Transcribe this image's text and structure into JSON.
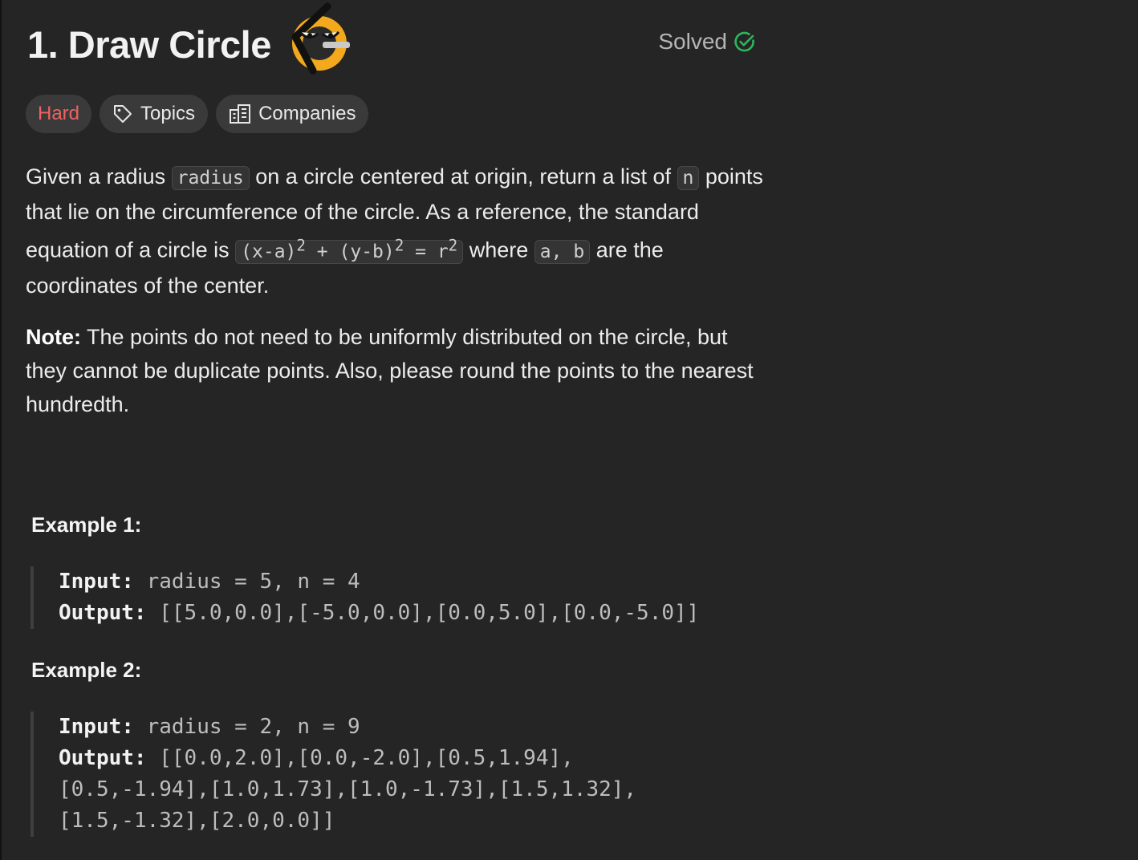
{
  "problem": {
    "title": "1. Draw Circle",
    "status": "Solved",
    "status_color": "#2db55d"
  },
  "tags": {
    "difficulty": "Hard",
    "difficulty_color": "#ef6262",
    "topics": "Topics",
    "companies": "Companies"
  },
  "description": {
    "t1": "Given a radius",
    "c1": "radius",
    "t2": "on a circle centered at origin, return a list of",
    "c2": "n",
    "t3": "points that lie on the circumference of the circle. As a reference, the standard equation of a circle is",
    "c3a": "(x-a)",
    "c3b": "2",
    "c3c": " + (y-b)",
    "c3d": "2",
    "c3e": " = r",
    "c3f": "2",
    "t4": "where",
    "c4": "a, b",
    "t5": "are the coordinates of the center."
  },
  "note": {
    "label": "Note:",
    "text": "The points do not need to be uniformly distributed on the circle, but they cannot be duplicate points. Also, please round the points to the nearest hundredth."
  },
  "examples": [
    {
      "heading": "Example 1:",
      "input_label": "Input:",
      "input": "radius = 5, n = 4",
      "output_label": "Output:",
      "output": "[[5.0,0.0],[-5.0,0.0],[0.0,5.0],[0.0,-5.0]]"
    },
    {
      "heading": "Example 2:",
      "input_label": "Input:",
      "input": "radius = 2, n = 9",
      "output_label": "Output:",
      "output": "[[0.0,2.0],[0.0,-2.0],[0.5,1.94],\n[0.5,-1.94],[1.0,1.73],[1.0,-1.73],[1.5,1.32],\n[1.5,-1.32],[2.0,0.0]]"
    }
  ],
  "icons": {
    "mascot": "mascot-icon",
    "solved": "check-circle-icon",
    "topics": "tag-icon",
    "companies": "building-icon"
  }
}
